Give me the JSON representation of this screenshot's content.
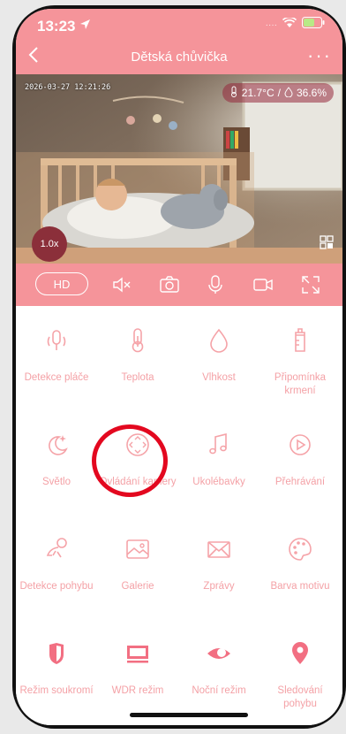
{
  "status": {
    "time": "13:23"
  },
  "nav": {
    "title": "Dětská chůvička",
    "more": "···"
  },
  "video": {
    "timestamp": "2026-03-27  12:21:26",
    "temperature": "21.7°C",
    "humidity": "36.6%",
    "zoom": "1.0x"
  },
  "controls": {
    "quality": "HD"
  },
  "tiles": [
    {
      "label": "Detekce pláče"
    },
    {
      "label": "Teplota"
    },
    {
      "label": "Vlhkost"
    },
    {
      "label": "Připomínka krmení"
    },
    {
      "label": "Světlo"
    },
    {
      "label": "Ovládání kamery"
    },
    {
      "label": "Ukolébavky"
    },
    {
      "label": "Přehrávání"
    },
    {
      "label": "Detekce pohybu"
    },
    {
      "label": "Galerie"
    },
    {
      "label": "Zprávy"
    },
    {
      "label": "Barva motivu"
    },
    {
      "label": "Režim soukromí"
    },
    {
      "label": "WDR režim"
    },
    {
      "label": "Noční režim"
    },
    {
      "label": "Sledování pohybu"
    }
  ],
  "colors": {
    "accent": "#f5949a",
    "tile_icon": "#f5a3a8",
    "tile_icon_bold": "#f26f82",
    "highlight": "#e3081f"
  }
}
